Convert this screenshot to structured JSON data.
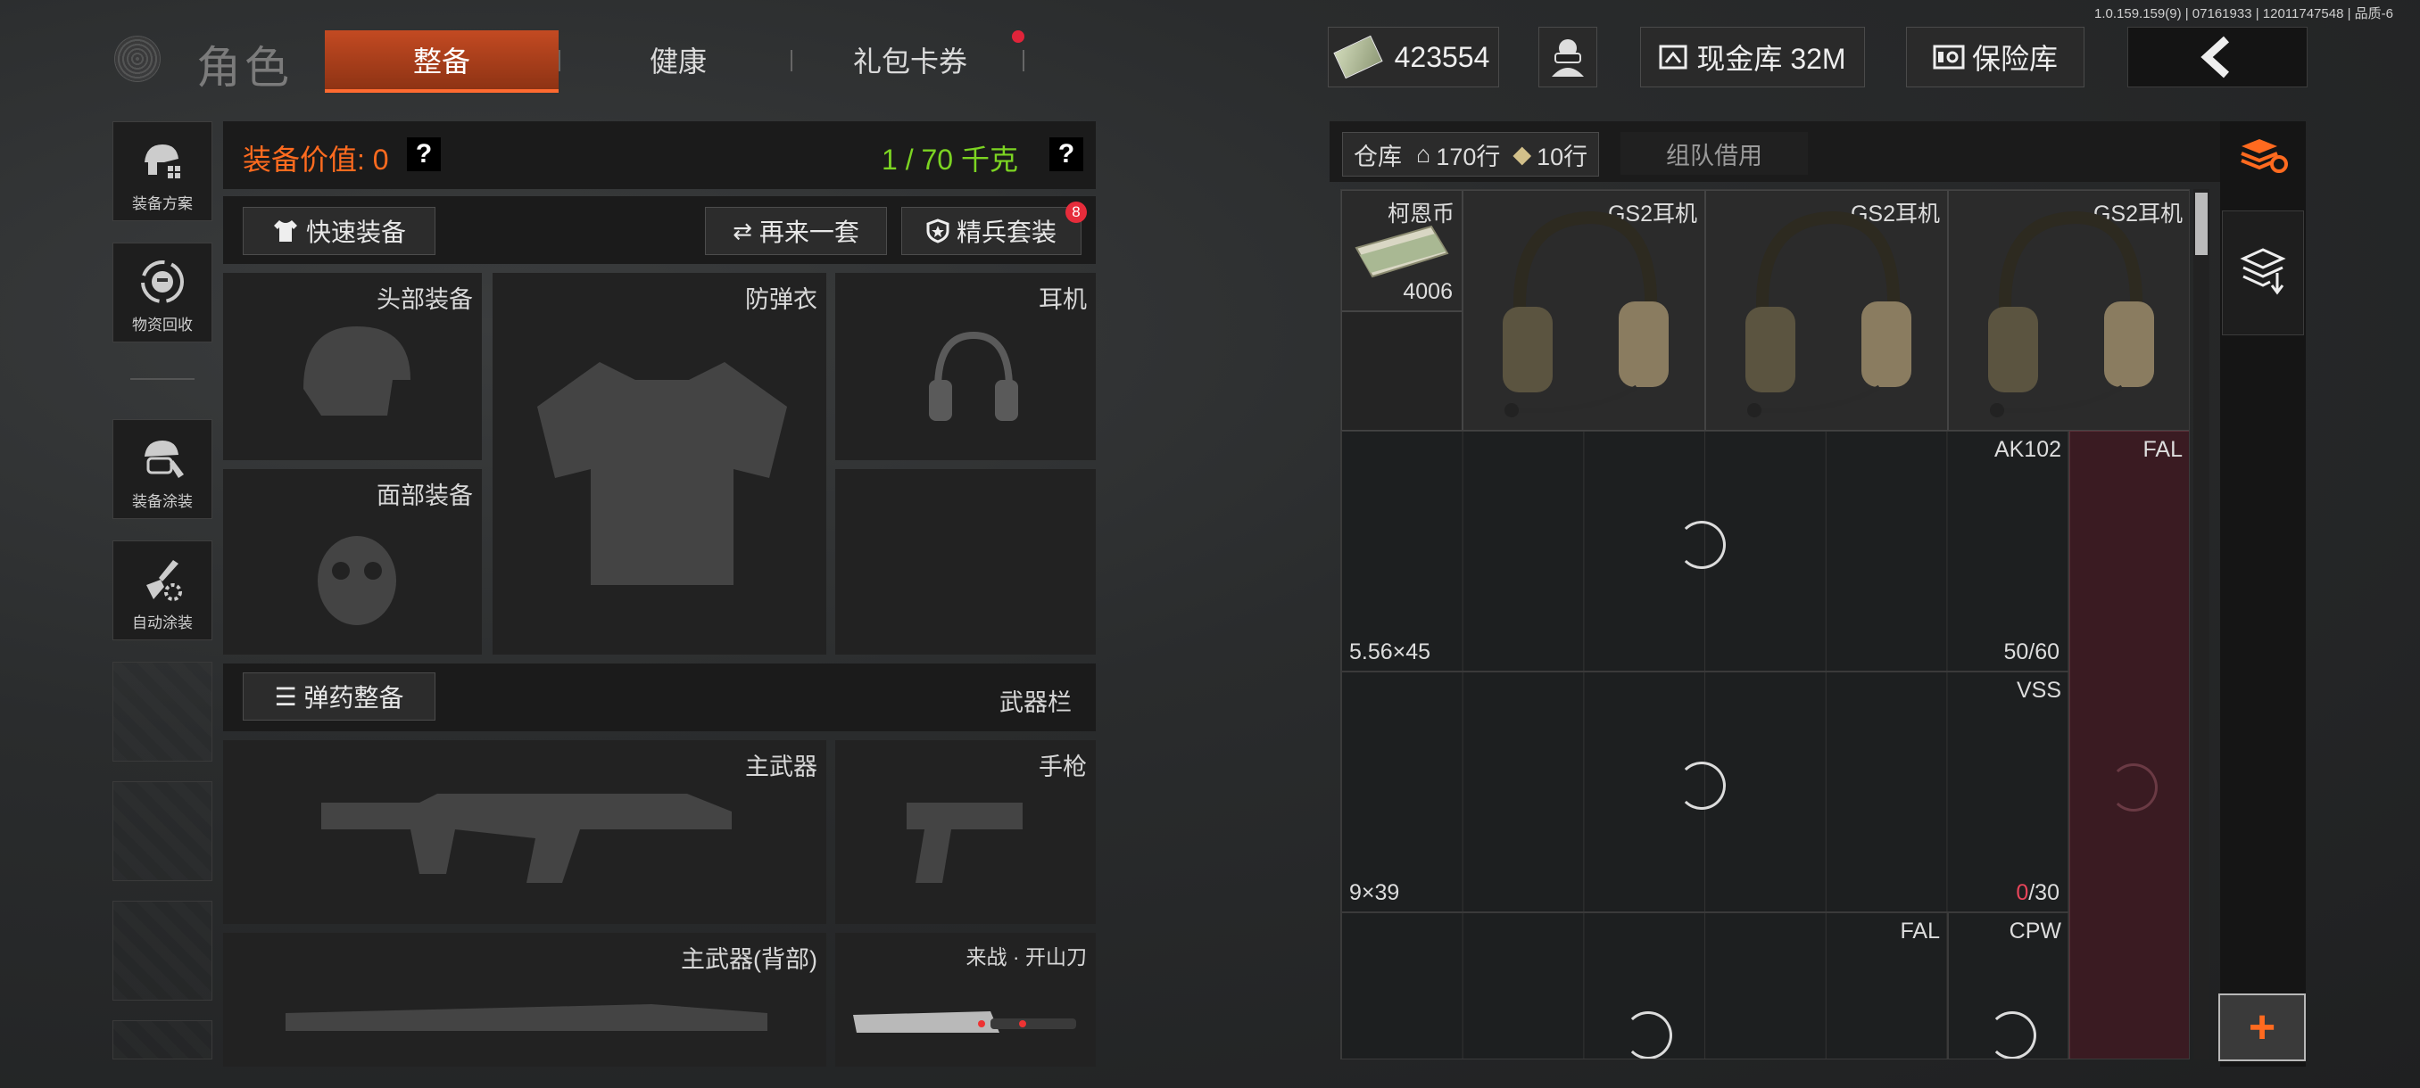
{
  "version": "1.0.159.159(9) | 07161933 | 12011747548 | 品质-6",
  "header": {
    "title": "角色",
    "tabs": [
      {
        "label": "整备",
        "active": true
      },
      {
        "label": "健康",
        "active": false
      },
      {
        "label": "礼包卡券",
        "active": false,
        "notify": true
      }
    ],
    "currency": "423554",
    "cash_vault": "现金库 32M",
    "safe": "保险库"
  },
  "sidebar": {
    "items": [
      {
        "label": "装备方案",
        "icon": "helmet-gear-icon"
      },
      {
        "label": "物资回收",
        "icon": "recycle-face-icon"
      },
      {
        "label": "装备涂装",
        "icon": "helmet-brush-icon"
      },
      {
        "label": "自动涂装",
        "icon": "brush-gear-icon"
      }
    ]
  },
  "equipment": {
    "value_label": "装备价值: 0",
    "weight": "1 / 70 千克",
    "help": "?",
    "quick_equip": "快速装备",
    "again": "再来一套",
    "elite": "精兵套装",
    "elite_badge": "8",
    "slots": {
      "head": "头部装备",
      "armor": "防弹衣",
      "headset": "耳机",
      "face": "面部装备",
      "primary": "主武器",
      "pistol": "手枪",
      "primary_back": "主武器(背部)",
      "melee": "来战 · 开山刀"
    },
    "ammo_btn": "弹药整备",
    "weapon_bar": "武器栏"
  },
  "stash": {
    "tab_label": "仓库",
    "rows_total": "170行",
    "rows_extra": "10行",
    "team_borrow": "组队借用",
    "items": {
      "coin_name": "柯恩币",
      "coin_count": "4006",
      "headset_name": "GS2耳机",
      "ak": "AK102",
      "fal": "FAL",
      "ak_cal": "5.56×45",
      "ak_ammo": "50/60",
      "vss": "VSS",
      "vss_cal": "9×39",
      "vss_ammo_zero": "0",
      "vss_ammo_rest": "/30",
      "fal2": "FAL",
      "cpw": "CPW"
    },
    "accent": "#ff6a1f",
    "highlight_col": "#3a1b22"
  }
}
